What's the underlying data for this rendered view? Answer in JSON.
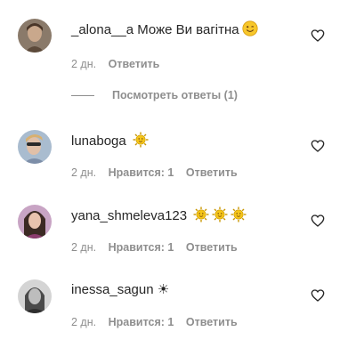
{
  "comments": [
    {
      "username": "_alona__a",
      "text": "Може Ви вагітна",
      "emoji": "smiling-face",
      "time": "2 дн.",
      "likes": "",
      "reply_label": "Ответить"
    },
    {
      "username": "lunaboga",
      "text": "",
      "emoji": "sun-with-face",
      "time": "2 дн.",
      "likes": "Нравится: 1",
      "reply_label": "Ответить"
    },
    {
      "username": "yana_shmeleva123",
      "text": "",
      "emoji": "sun-with-face x3",
      "time": "2 дн.",
      "likes": "Нравится: 1",
      "reply_label": "Ответить"
    },
    {
      "username": "inessa_sagun",
      "text": "☀",
      "emoji": "",
      "time": "2 дн.",
      "likes": "Нравится: 1",
      "reply_label": "Ответить"
    }
  ],
  "view_replies_label": "Посмотреть ответы (1)",
  "colors": {
    "text": "#262626",
    "secondary": "#8e8e8e",
    "emoji_yellow": "#f5c518"
  },
  "icons": {
    "like": "heart-outline-icon"
  }
}
